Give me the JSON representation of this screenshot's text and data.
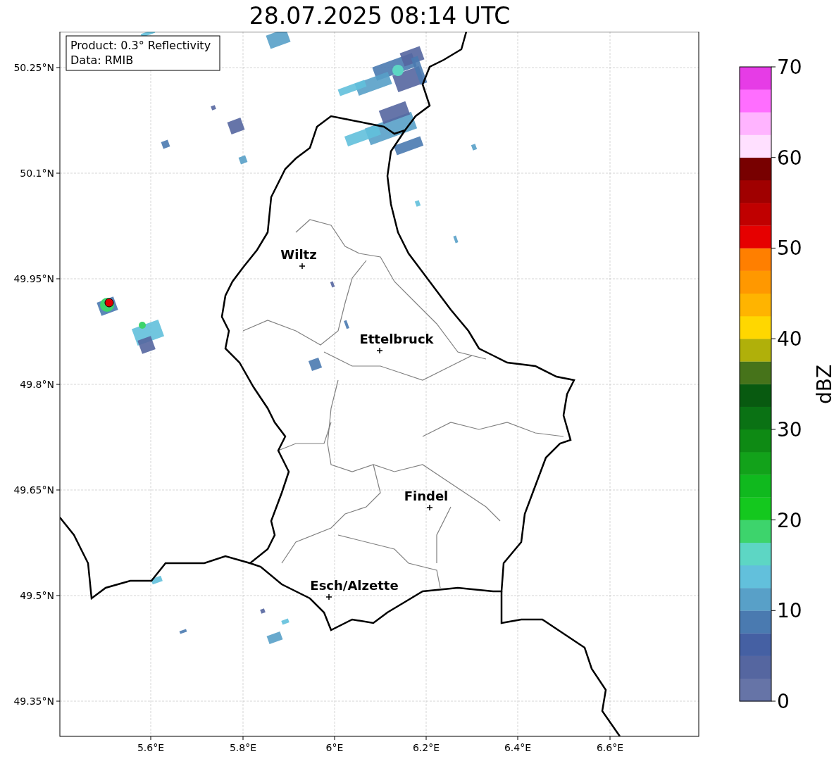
{
  "title": "28.07.2025 08:14 UTC",
  "info_box": [
    "Product: 0.3° Reflectivity",
    "Data: RMIB"
  ],
  "map": {
    "y_ticks": [
      "50.25°N",
      "50.1°N",
      "49.95°N",
      "49.8°N",
      "49.65°N",
      "49.5°N",
      "49.35°N"
    ],
    "x_ticks": [
      "5.6°E",
      "5.8°E",
      "6°E",
      "6.2°E",
      "6.4°E",
      "6.6°E"
    ],
    "cities": [
      {
        "name": "Wiltz"
      },
      {
        "name": "Ettelbruck"
      },
      {
        "name": "Findel"
      },
      {
        "name": "Esch/Alzette"
      }
    ]
  },
  "colorbar": {
    "label": "dBZ",
    "ticks": [
      "70",
      "60",
      "50",
      "40",
      "30",
      "20",
      "10",
      "0"
    ],
    "bins": [
      {
        "color": "#6674a7"
      },
      {
        "color": "#5566a0"
      },
      {
        "color": "#4560a3"
      },
      {
        "color": "#4a7ab0"
      },
      {
        "color": "#58a0c8"
      },
      {
        "color": "#62c0dc"
      },
      {
        "color": "#5dd6c4"
      },
      {
        "color": "#3dd46c"
      },
      {
        "color": "#14c81e"
      },
      {
        "color": "#10b91e"
      },
      {
        "color": "#12a21a"
      },
      {
        "color": "#0e8a14"
      },
      {
        "color": "#0a7214"
      },
      {
        "color": "#085a10"
      },
      {
        "color": "#46731a"
      },
      {
        "color": "#b0b00a"
      },
      {
        "color": "#ffd700"
      },
      {
        "color": "#ffb400"
      },
      {
        "color": "#ff9800"
      },
      {
        "color": "#ff7f00"
      },
      {
        "color": "#e60000"
      },
      {
        "color": "#c00000"
      },
      {
        "color": "#a00000"
      },
      {
        "color": "#780000"
      },
      {
        "color": "#ffe0ff"
      },
      {
        "color": "#ffb4ff"
      },
      {
        "color": "#ff6eff"
      },
      {
        "color": "#e63ce6"
      }
    ]
  }
}
